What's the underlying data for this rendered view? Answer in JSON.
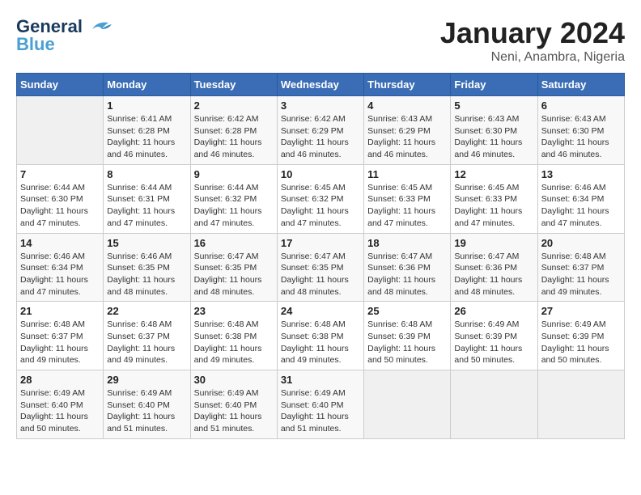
{
  "logo": {
    "line1": "General",
    "line2": "Blue"
  },
  "title": "January 2024",
  "subtitle": "Neni, Anambra, Nigeria",
  "weekdays": [
    "Sunday",
    "Monday",
    "Tuesday",
    "Wednesday",
    "Thursday",
    "Friday",
    "Saturday"
  ],
  "weeks": [
    [
      {
        "day": "",
        "info": ""
      },
      {
        "day": "1",
        "info": "Sunrise: 6:41 AM\nSunset: 6:28 PM\nDaylight: 11 hours and 46 minutes."
      },
      {
        "day": "2",
        "info": "Sunrise: 6:42 AM\nSunset: 6:28 PM\nDaylight: 11 hours and 46 minutes."
      },
      {
        "day": "3",
        "info": "Sunrise: 6:42 AM\nSunset: 6:29 PM\nDaylight: 11 hours and 46 minutes."
      },
      {
        "day": "4",
        "info": "Sunrise: 6:43 AM\nSunset: 6:29 PM\nDaylight: 11 hours and 46 minutes."
      },
      {
        "day": "5",
        "info": "Sunrise: 6:43 AM\nSunset: 6:30 PM\nDaylight: 11 hours and 46 minutes."
      },
      {
        "day": "6",
        "info": "Sunrise: 6:43 AM\nSunset: 6:30 PM\nDaylight: 11 hours and 46 minutes."
      }
    ],
    [
      {
        "day": "7",
        "info": "Sunrise: 6:44 AM\nSunset: 6:30 PM\nDaylight: 11 hours and 47 minutes."
      },
      {
        "day": "8",
        "info": "Sunrise: 6:44 AM\nSunset: 6:31 PM\nDaylight: 11 hours and 47 minutes."
      },
      {
        "day": "9",
        "info": "Sunrise: 6:44 AM\nSunset: 6:32 PM\nDaylight: 11 hours and 47 minutes."
      },
      {
        "day": "10",
        "info": "Sunrise: 6:45 AM\nSunset: 6:32 PM\nDaylight: 11 hours and 47 minutes."
      },
      {
        "day": "11",
        "info": "Sunrise: 6:45 AM\nSunset: 6:33 PM\nDaylight: 11 hours and 47 minutes."
      },
      {
        "day": "12",
        "info": "Sunrise: 6:45 AM\nSunset: 6:33 PM\nDaylight: 11 hours and 47 minutes."
      },
      {
        "day": "13",
        "info": "Sunrise: 6:46 AM\nSunset: 6:34 PM\nDaylight: 11 hours and 47 minutes."
      }
    ],
    [
      {
        "day": "14",
        "info": "Sunrise: 6:46 AM\nSunset: 6:34 PM\nDaylight: 11 hours and 47 minutes."
      },
      {
        "day": "15",
        "info": "Sunrise: 6:46 AM\nSunset: 6:35 PM\nDaylight: 11 hours and 48 minutes."
      },
      {
        "day": "16",
        "info": "Sunrise: 6:47 AM\nSunset: 6:35 PM\nDaylight: 11 hours and 48 minutes."
      },
      {
        "day": "17",
        "info": "Sunrise: 6:47 AM\nSunset: 6:35 PM\nDaylight: 11 hours and 48 minutes."
      },
      {
        "day": "18",
        "info": "Sunrise: 6:47 AM\nSunset: 6:36 PM\nDaylight: 11 hours and 48 minutes."
      },
      {
        "day": "19",
        "info": "Sunrise: 6:47 AM\nSunset: 6:36 PM\nDaylight: 11 hours and 48 minutes."
      },
      {
        "day": "20",
        "info": "Sunrise: 6:48 AM\nSunset: 6:37 PM\nDaylight: 11 hours and 49 minutes."
      }
    ],
    [
      {
        "day": "21",
        "info": "Sunrise: 6:48 AM\nSunset: 6:37 PM\nDaylight: 11 hours and 49 minutes."
      },
      {
        "day": "22",
        "info": "Sunrise: 6:48 AM\nSunset: 6:37 PM\nDaylight: 11 hours and 49 minutes."
      },
      {
        "day": "23",
        "info": "Sunrise: 6:48 AM\nSunset: 6:38 PM\nDaylight: 11 hours and 49 minutes."
      },
      {
        "day": "24",
        "info": "Sunrise: 6:48 AM\nSunset: 6:38 PM\nDaylight: 11 hours and 49 minutes."
      },
      {
        "day": "25",
        "info": "Sunrise: 6:48 AM\nSunset: 6:39 PM\nDaylight: 11 hours and 50 minutes."
      },
      {
        "day": "26",
        "info": "Sunrise: 6:49 AM\nSunset: 6:39 PM\nDaylight: 11 hours and 50 minutes."
      },
      {
        "day": "27",
        "info": "Sunrise: 6:49 AM\nSunset: 6:39 PM\nDaylight: 11 hours and 50 minutes."
      }
    ],
    [
      {
        "day": "28",
        "info": "Sunrise: 6:49 AM\nSunset: 6:40 PM\nDaylight: 11 hours and 50 minutes."
      },
      {
        "day": "29",
        "info": "Sunrise: 6:49 AM\nSunset: 6:40 PM\nDaylight: 11 hours and 51 minutes."
      },
      {
        "day": "30",
        "info": "Sunrise: 6:49 AM\nSunset: 6:40 PM\nDaylight: 11 hours and 51 minutes."
      },
      {
        "day": "31",
        "info": "Sunrise: 6:49 AM\nSunset: 6:40 PM\nDaylight: 11 hours and 51 minutes."
      },
      {
        "day": "",
        "info": ""
      },
      {
        "day": "",
        "info": ""
      },
      {
        "day": "",
        "info": ""
      }
    ]
  ]
}
